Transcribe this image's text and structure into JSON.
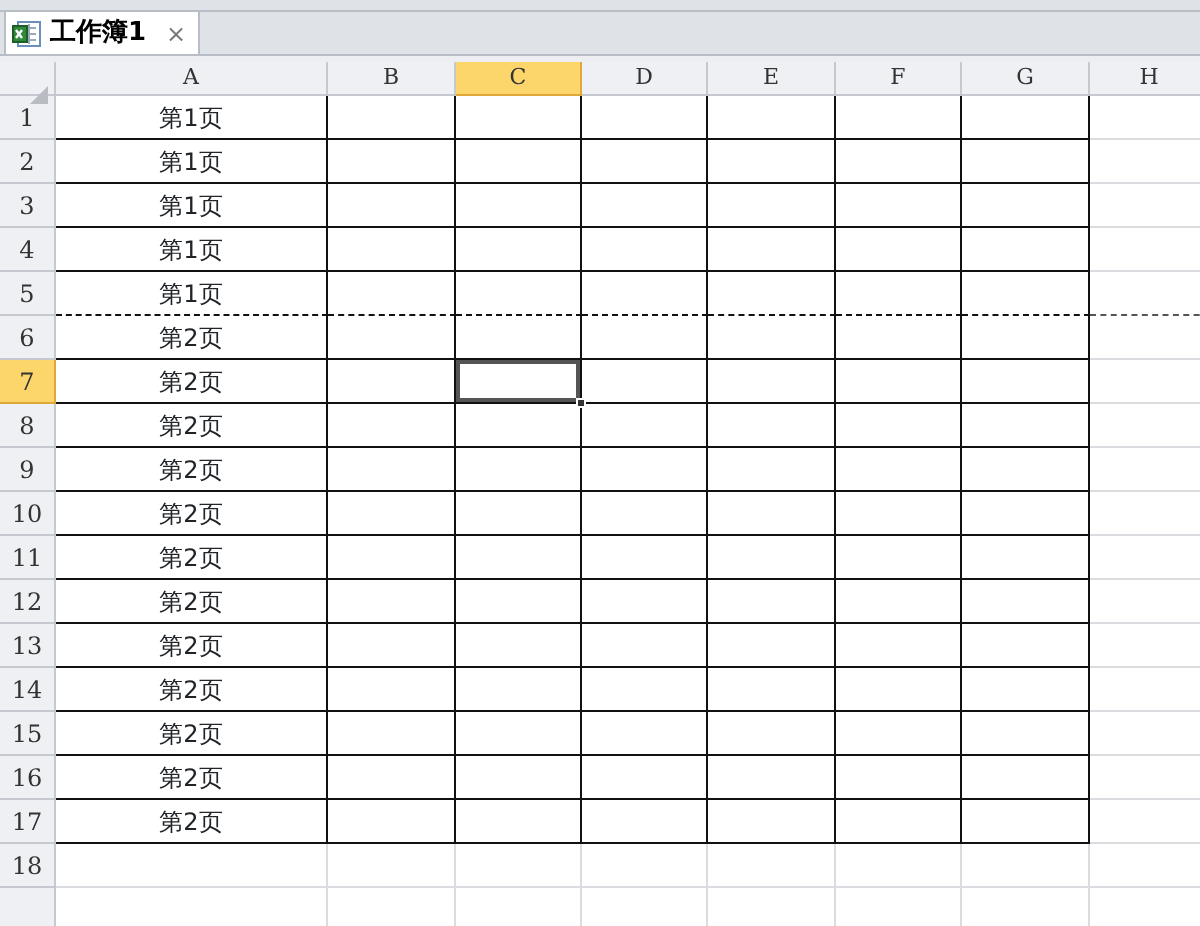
{
  "tab": {
    "title": "工作簿1",
    "close": "×",
    "selected": true
  },
  "columns": [
    {
      "label": "A",
      "selected": false
    },
    {
      "label": "B",
      "selected": false
    },
    {
      "label": "C",
      "selected": true
    },
    {
      "label": "D",
      "selected": false
    },
    {
      "label": "E",
      "selected": false
    },
    {
      "label": "F",
      "selected": false
    },
    {
      "label": "G",
      "selected": false
    },
    {
      "label": "H",
      "selected": false
    }
  ],
  "rows": [
    {
      "label": "1",
      "selected": false,
      "bordered": true,
      "page_break_after": false,
      "cells": [
        "第1页"
      ]
    },
    {
      "label": "2",
      "selected": false,
      "bordered": true,
      "page_break_after": false,
      "cells": [
        "第1页"
      ]
    },
    {
      "label": "3",
      "selected": false,
      "bordered": true,
      "page_break_after": false,
      "cells": [
        "第1页"
      ]
    },
    {
      "label": "4",
      "selected": false,
      "bordered": true,
      "page_break_after": false,
      "cells": [
        "第1页"
      ]
    },
    {
      "label": "5",
      "selected": false,
      "bordered": true,
      "page_break_after": true,
      "cells": [
        "第1页"
      ]
    },
    {
      "label": "6",
      "selected": false,
      "bordered": true,
      "page_break_after": false,
      "cells": [
        "第2页"
      ]
    },
    {
      "label": "7",
      "selected": true,
      "bordered": true,
      "page_break_after": false,
      "cells": [
        "第2页"
      ]
    },
    {
      "label": "8",
      "selected": false,
      "bordered": true,
      "page_break_after": false,
      "cells": [
        "第2页"
      ]
    },
    {
      "label": "9",
      "selected": false,
      "bordered": true,
      "page_break_after": false,
      "cells": [
        "第2页"
      ]
    },
    {
      "label": "10",
      "selected": false,
      "bordered": true,
      "page_break_after": false,
      "cells": [
        "第2页"
      ]
    },
    {
      "label": "11",
      "selected": false,
      "bordered": true,
      "page_break_after": false,
      "cells": [
        "第2页"
      ]
    },
    {
      "label": "12",
      "selected": false,
      "bordered": true,
      "page_break_after": false,
      "cells": [
        "第2页"
      ]
    },
    {
      "label": "13",
      "selected": false,
      "bordered": true,
      "page_break_after": false,
      "cells": [
        "第2页"
      ]
    },
    {
      "label": "14",
      "selected": false,
      "bordered": true,
      "page_break_after": false,
      "cells": [
        "第2页"
      ]
    },
    {
      "label": "15",
      "selected": false,
      "bordered": true,
      "page_break_after": false,
      "cells": [
        "第2页"
      ]
    },
    {
      "label": "16",
      "selected": false,
      "bordered": true,
      "page_break_after": false,
      "cells": [
        "第2页"
      ]
    },
    {
      "label": "17",
      "selected": false,
      "bordered": true,
      "page_break_after": false,
      "cells": [
        "第2页"
      ]
    },
    {
      "label": "18",
      "selected": false,
      "bordered": false,
      "page_break_after": false,
      "cells": []
    }
  ]
}
